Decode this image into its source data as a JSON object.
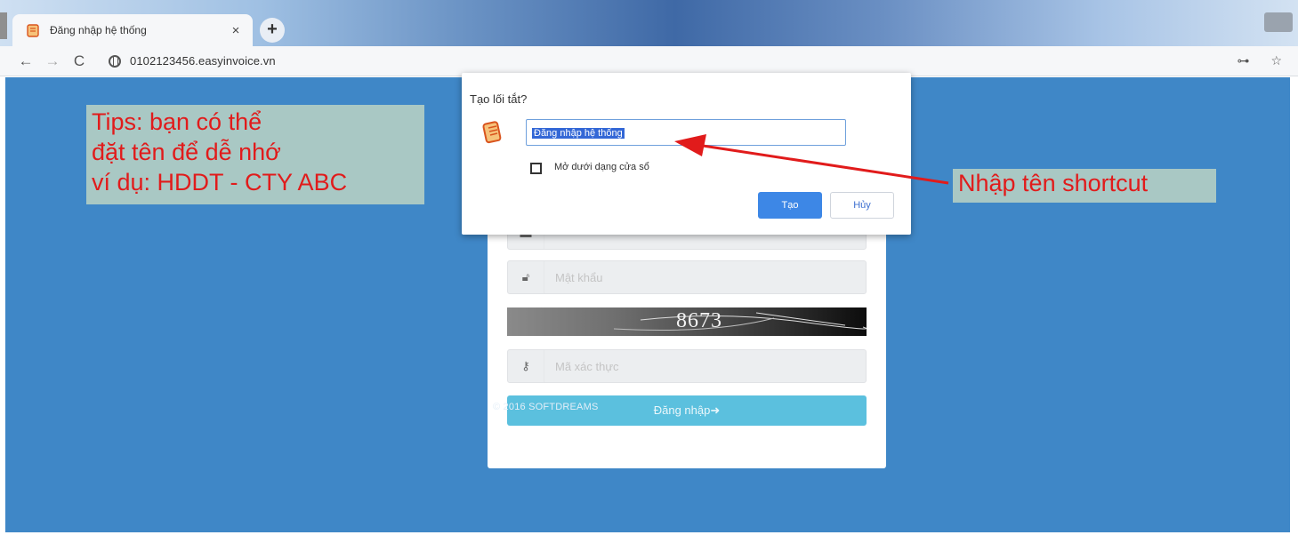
{
  "browser": {
    "tab_title": "Đăng nhập hệ thống",
    "tab_close": "×",
    "new_tab": "+",
    "url": "0102123456.easyinvoice.vn",
    "back": "←",
    "forward": "→",
    "reload": "C",
    "key_glyph": "⊶",
    "extra_glyph": "☆"
  },
  "login": {
    "password_placeholder": "Mật khẩu",
    "captcha_text": "8673",
    "code_placeholder": "Mã xác thực",
    "submit_label": "Đăng nhập➜",
    "copyright": "© 2016 SOFTDREAMS"
  },
  "dialog": {
    "title": "Tạo lối tắt?",
    "name_value": "Đăng nhập hệ thống",
    "checkbox_label": "Mở dưới dạng cửa sổ",
    "create_label": "Tạo",
    "cancel_label": "Hủy"
  },
  "annotations": {
    "tips_lines": [
      "Tips: bạn có thể",
      "đặt tên để dễ nhớ",
      "ví dụ: HDDT - CTY ABC"
    ],
    "callout": "Nhập tên shortcut"
  },
  "colors": {
    "page_bg": "#3f87c7",
    "login_button": "#5bc0de",
    "dialog_primary": "#3d87e6",
    "annotation_text": "#e11b1b",
    "annotation_bg": "#a9c8c4"
  }
}
